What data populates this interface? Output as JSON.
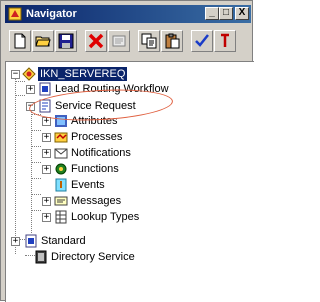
{
  "window": {
    "title": "Navigator",
    "minimize_label": "_",
    "restore_label": "□",
    "close_label": "X"
  },
  "toolbar": {
    "buttons": [
      {
        "icon": "new-document-icon"
      },
      {
        "icon": "open-folder-icon"
      },
      {
        "icon": "save-icon"
      },
      {
        "icon": "delete-icon"
      },
      {
        "icon": "properties-icon"
      },
      {
        "icon": "copy-icon"
      },
      {
        "icon": "paste-icon"
      },
      {
        "icon": "check-icon"
      },
      {
        "icon": "pointer-icon"
      }
    ]
  },
  "tree": {
    "root": {
      "label": "IKN_SERVEREQ",
      "expander": "−"
    },
    "items": [
      {
        "label": "Lead Routing Workflow",
        "expander": "+"
      },
      {
        "label": "Service Request",
        "expander": "−"
      },
      {
        "label": "Attributes",
        "expander": "+"
      },
      {
        "label": "Processes",
        "expander": "+"
      },
      {
        "label": "Notifications",
        "expander": "+"
      },
      {
        "label": "Functions",
        "expander": "+"
      },
      {
        "label": "Events",
        "expander": ""
      },
      {
        "label": "Messages",
        "expander": "+"
      },
      {
        "label": "Lookup Types",
        "expander": "+"
      },
      {
        "label": "Standard",
        "expander": "+"
      },
      {
        "label": "Directory Service",
        "expander": ""
      }
    ]
  },
  "colors": {
    "selection": "#0a246a",
    "annotation": "#e06040",
    "titlebar_start": "#0a246a",
    "titlebar_end": "#3a6ea5"
  }
}
